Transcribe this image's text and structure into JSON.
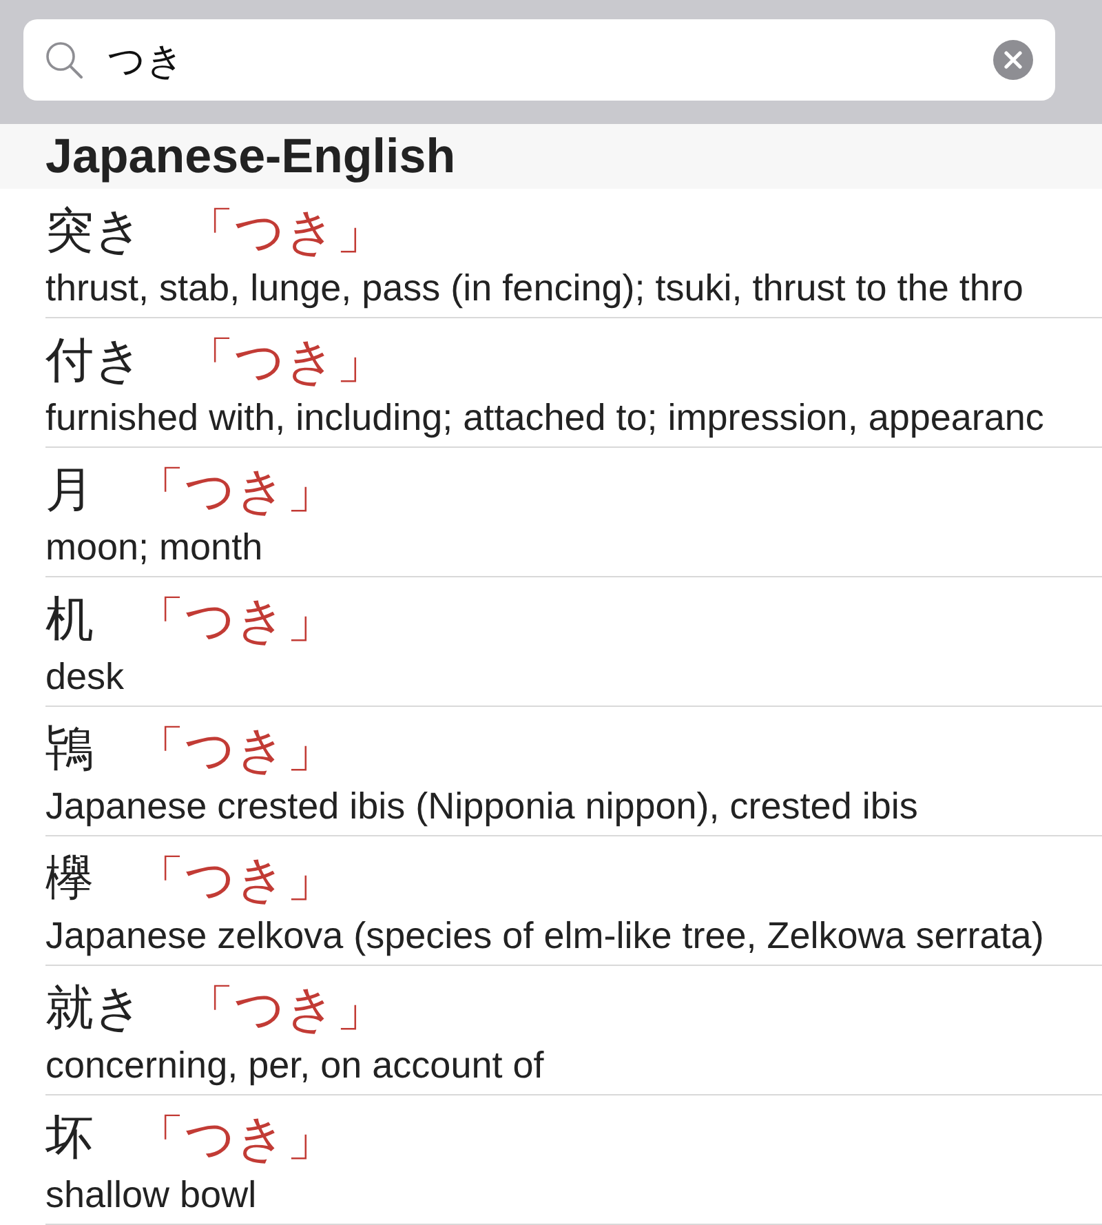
{
  "search": {
    "value": "つき"
  },
  "section": {
    "title": "Japanese-English"
  },
  "entries": [
    {
      "headword": "突き",
      "reading": "「つき」",
      "gloss": "thrust, stab, lunge, pass (in fencing); tsuki, thrust to the thro"
    },
    {
      "headword": "付き",
      "reading": "「つき」",
      "gloss": "furnished with, including; attached to; impression, appearanc"
    },
    {
      "headword": "月",
      "reading": "「つき」",
      "gloss": "moon; month"
    },
    {
      "headword": "机",
      "reading": "「つき」",
      "gloss": "desk"
    },
    {
      "headword": "鴇",
      "reading": "「つき」",
      "gloss": "Japanese crested ibis (Nipponia nippon), crested ibis"
    },
    {
      "headword": "欅",
      "reading": "「つき」",
      "gloss": "Japanese zelkova (species of elm-like tree, Zelkowa serrata)"
    },
    {
      "headword": "就き",
      "reading": "「つき」",
      "gloss": "concerning, per, on account of"
    },
    {
      "headword": "坏",
      "reading": "「つき」",
      "gloss": "shallow bowl"
    }
  ]
}
